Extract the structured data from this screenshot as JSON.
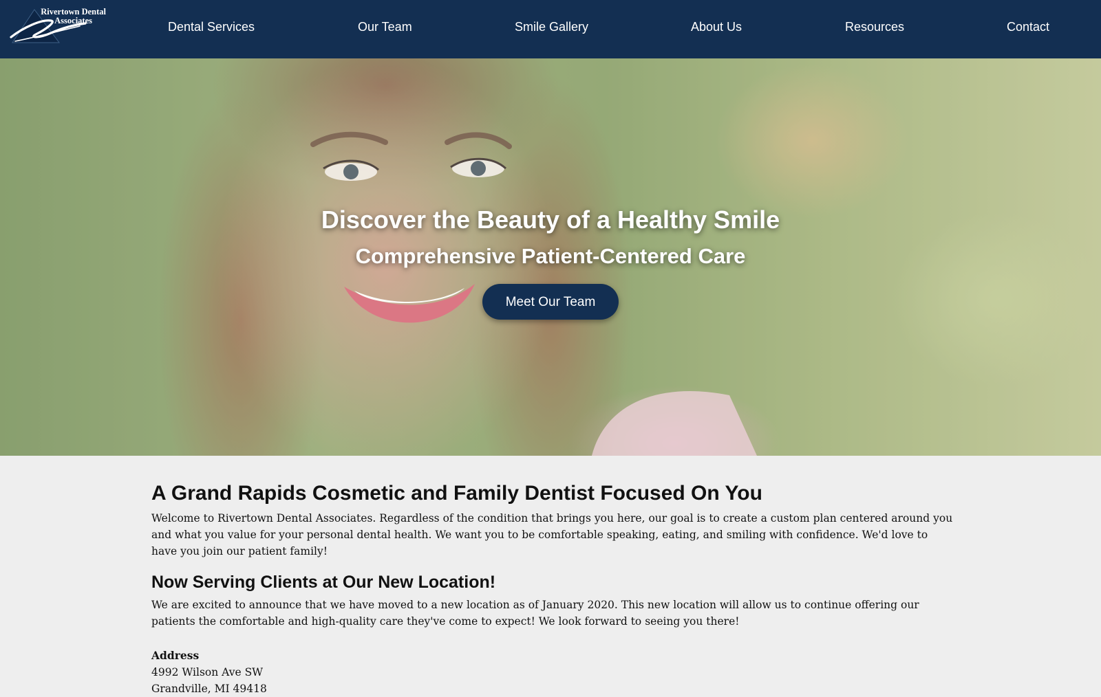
{
  "header": {
    "logo": {
      "line1": "Rivertown Dental",
      "line2": "Associates"
    },
    "nav": [
      {
        "label": "Dental Services"
      },
      {
        "label": "Our Team"
      },
      {
        "label": "Smile Gallery"
      },
      {
        "label": "About Us"
      },
      {
        "label": "Resources"
      },
      {
        "label": "Contact"
      }
    ]
  },
  "hero": {
    "title": "Discover the Beauty of a Healthy Smile",
    "subtitle": "Comprehensive Patient-Centered Care",
    "cta_label": "Meet Our Team"
  },
  "main": {
    "heading": "A Grand Rapids Cosmetic and Family Dentist Focused On You",
    "intro": "Welcome to Rivertown Dental Associates. Regardless of the condition that brings you here, our goal is to create a custom plan centered around you and what you value for your personal dental health. We want you to be comfortable speaking, eating, and smiling with confidence. We'd love to have you join our patient family!",
    "location_heading": "Now Serving Clients at Our New Location!",
    "location_text": "We are excited to announce that we have moved to a new location as of January 2020. This new location will allow us to continue offering our patients the comfortable and high-quality care they've come to expect! We look forward to seeing you there!",
    "address_label": "Address",
    "address_line1": "4992 Wilson Ave SW",
    "address_line2": "Grandville, MI 49418"
  },
  "colors": {
    "brand_navy": "#132f52",
    "page_background": "#eeeeee",
    "text": "#111111"
  }
}
